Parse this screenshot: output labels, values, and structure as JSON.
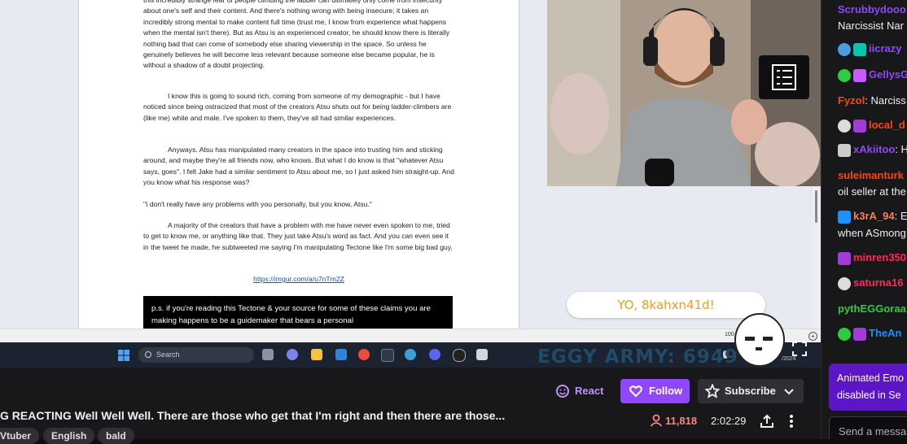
{
  "document": {
    "p1": "this incredibly strange fear of people climbing the ladder can ultimately only come from insecurity about one's self and their content. And there's nothing wrong with being insecure; it takes an incredibly strong mental to make content full time (trust me, I know from experience what happens when the mental isn't there). But as Atsu is an experienced creator, he should know there is literally nothing bad that can come of somebody else sharing viewership in the space. So unless he genuinely believes he will become less relevant because someone else became popular, he is without a shadow of a doubt projecting.",
    "p2": "I know this is going to sound rich, coming from someone of my demographic - but I have noticed since being ostracized that most of the creators Atsu shuts out for being ladder-climbers are (like me) white and male. I've spoken to them, they've all had similar experiences.",
    "p3": "Anyways. Atsu has manipulated many creators in the space into trusting him and sticking around, and maybe they're all friends now, who knows. But what I do know is that \"whatever Atsu says, goes\". I felt Jake had a similar sentiment to Atsu about me, so I just asked him straight-up. And you know what his response was?",
    "p4": "\"I don't really have any problems with you personally, but you know, Atsu.\"",
    "p5": "A majority of the creators that have a problem with me have never even spoken to me, tried to get to know me, or anything like that. They just take Atsu's word as fact. And you can even see it in the tweet he made, he subtweeted me saying I'm manipulating Tectone like I'm some big bad guy.",
    "link": "https://imgur.com/a/u7nTm2Z",
    "ps": "p.s. if you're reading this Tectone & your source for some of these claims you are making happens to be a guidemaker that bears a personal"
  },
  "viewer": {
    "zoom": "100",
    "date": "/2024"
  },
  "taskbar": {
    "search_placeholder": "Search"
  },
  "overlay": {
    "eggy_counter": "EGGY ARMY: 6949",
    "bubble_text": "YO, 8kahxn41d!"
  },
  "stream_info": {
    "title": "G REACTING Well Well Well. There are those who get that I'm right and then there are those...",
    "tags": [
      "Vtuber",
      "English",
      "bald"
    ],
    "react_label": "React",
    "follow_label": "Follow",
    "subscribe_label": "Subscribe",
    "viewers": "11,818",
    "uptime": "2:02:29"
  },
  "chat": {
    "messages": [
      {
        "user": "Scrubbydooo",
        "color": "#9147ff",
        "text": ""
      },
      {
        "user": "",
        "color": "#efeff1",
        "text": "Narcissist Nar"
      },
      {
        "user": "iicrazy",
        "color": "#9147ff",
        "text": ""
      },
      {
        "user": "GellysG",
        "color": "#9147ff",
        "text": ""
      },
      {
        "user": "Fyzol",
        "color": "#ff4500",
        "text": ": Narciss"
      },
      {
        "user": "local_d",
        "color": "#ff4500",
        "text": ""
      },
      {
        "user": "xAkiitoo",
        "color": "#9147ff",
        "text": ": H"
      },
      {
        "user": "suleimanturk",
        "color": "#ff4500",
        "text": ""
      },
      {
        "user": "",
        "color": "#efeff1",
        "text": "oil seller at the"
      },
      {
        "user": "k3rA_94",
        "color": "#ff7f50",
        "text": ": E"
      },
      {
        "user": "",
        "color": "#efeff1",
        "text": "when ASmong"
      },
      {
        "user": "minren350",
        "color": "#ff2a5a",
        "text": ""
      },
      {
        "user": "saturna16",
        "color": "#ff2a5a",
        "text": ""
      },
      {
        "user": "pythEGGoraa",
        "color": "#2ecc40",
        "text": ""
      },
      {
        "user": "TheAn",
        "color": "#1e90ff",
        "text": ""
      }
    ],
    "notice": "Animated Emo\ndisabled in Se",
    "send_placeholder": "Send a messa"
  }
}
